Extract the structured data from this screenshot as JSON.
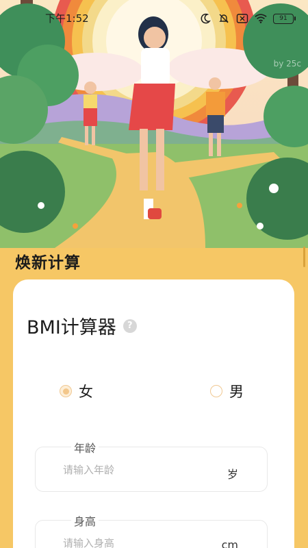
{
  "status_bar": {
    "time": "下午1:52",
    "battery": "91",
    "icons": [
      "moon-icon",
      "bell-off-icon",
      "sim-off-icon",
      "wifi-icon",
      "battery-icon"
    ]
  },
  "hero": {
    "watermark": "by 25c",
    "description_icon": "walking-people-illustration"
  },
  "section_title": "焕新计算",
  "calculator": {
    "title": "BMI计算器",
    "help_icon": "?",
    "gender": {
      "female": "女",
      "male": "男",
      "selected": "female"
    },
    "age": {
      "label": "年龄",
      "placeholder": "请输入年龄",
      "unit": "岁"
    },
    "height": {
      "label": "身高",
      "placeholder": "请输入身高",
      "unit": "cm"
    }
  },
  "colors": {
    "accent": "#f6c765",
    "radio": "#f3c78b",
    "card": "#ffffff"
  }
}
